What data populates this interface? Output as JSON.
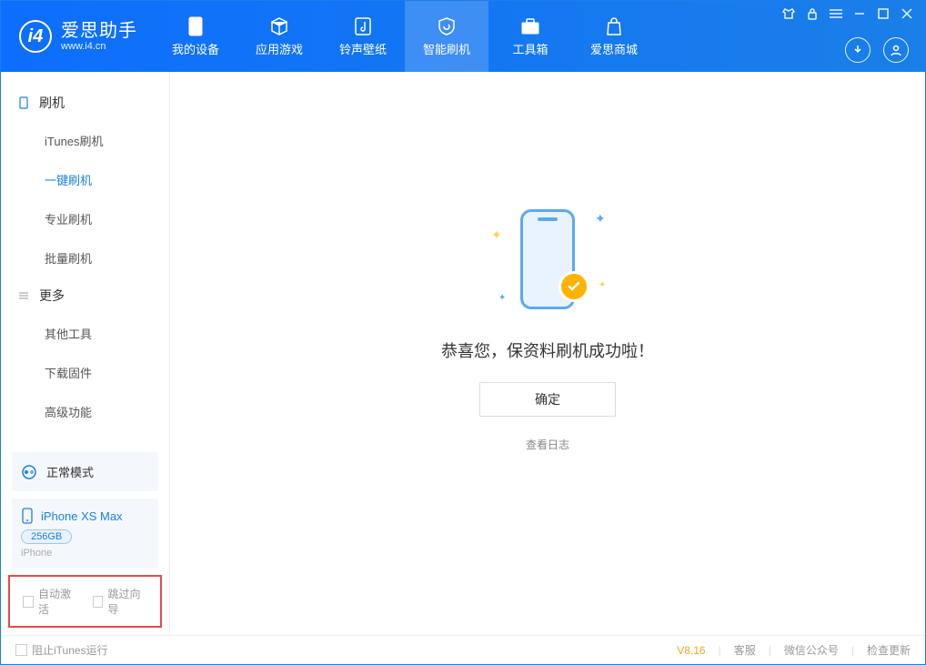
{
  "app": {
    "title": "爱思助手",
    "subtitle": "www.i4.cn"
  },
  "nav": [
    {
      "label": "我的设备"
    },
    {
      "label": "应用游戏"
    },
    {
      "label": "铃声壁纸"
    },
    {
      "label": "智能刷机"
    },
    {
      "label": "工具箱"
    },
    {
      "label": "爱思商城"
    }
  ],
  "sidebar": {
    "group1_title": "刷机",
    "items1": [
      {
        "label": "iTunes刷机"
      },
      {
        "label": "一键刷机"
      },
      {
        "label": "专业刷机"
      },
      {
        "label": "批量刷机"
      }
    ],
    "group2_title": "更多",
    "items2": [
      {
        "label": "其他工具"
      },
      {
        "label": "下载固件"
      },
      {
        "label": "高级功能"
      }
    ]
  },
  "status": {
    "mode": "正常模式"
  },
  "device": {
    "name": "iPhone XS Max",
    "storage": "256GB",
    "type": "iPhone"
  },
  "checks": {
    "auto_activate": "自动激活",
    "skip_guide": "跳过向导"
  },
  "main": {
    "success_text": "恭喜您，保资料刷机成功啦！",
    "ok_label": "确定",
    "log_link": "查看日志"
  },
  "footer": {
    "block_itunes": "阻止iTunes运行",
    "version": "V8.16",
    "service": "客服",
    "wechat": "微信公众号",
    "update": "检查更新"
  }
}
